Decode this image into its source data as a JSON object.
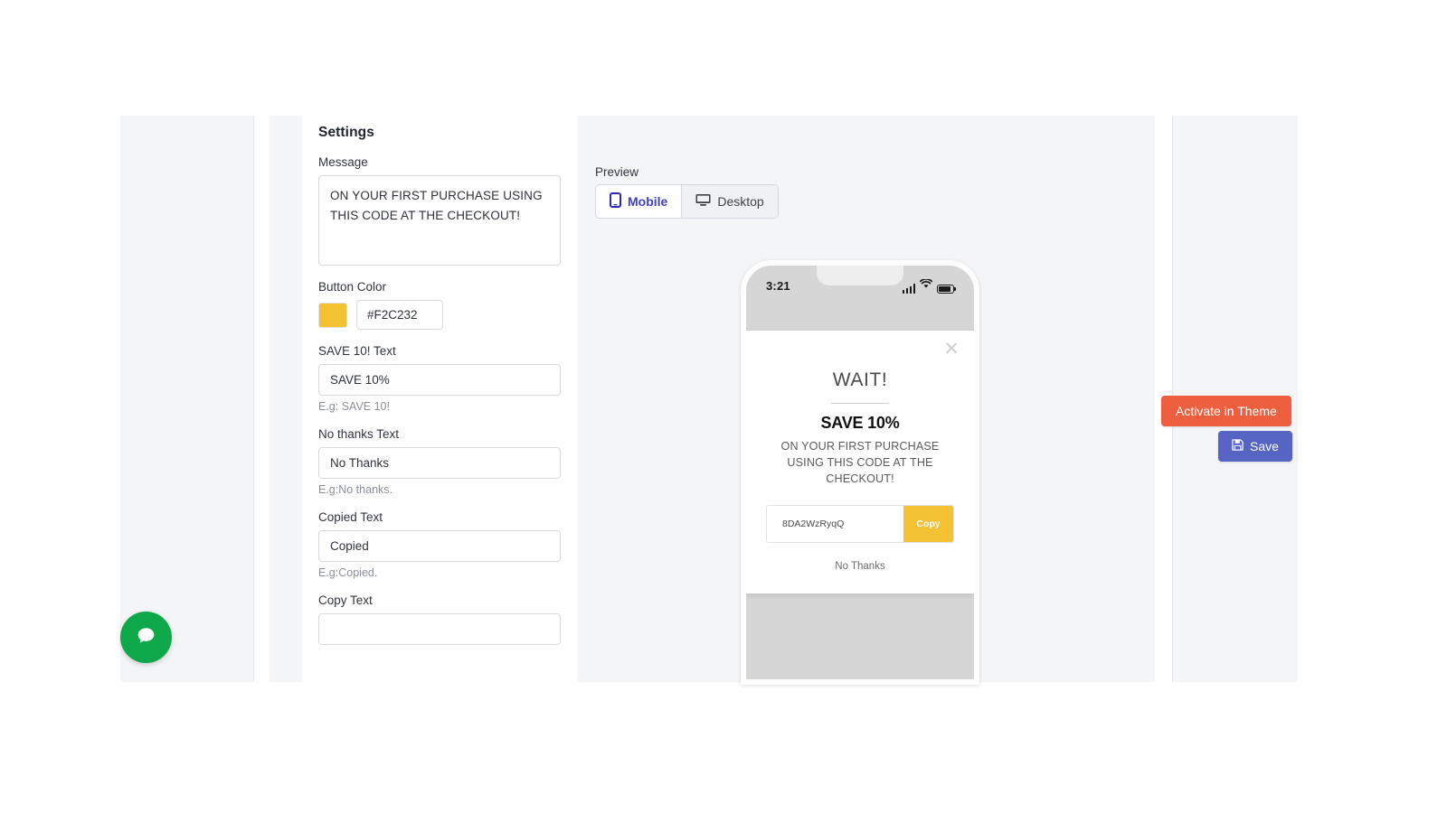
{
  "settings": {
    "title": "Settings",
    "fields": {
      "message": {
        "label": "Message",
        "value": "ON YOUR FIRST PURCHASE USING THIS CODE AT THE CHECKOUT!"
      },
      "button_color": {
        "label": "Button Color",
        "value": "#F2C232",
        "swatch_color": "#F2C232"
      },
      "save_text": {
        "label": "SAVE 10! Text",
        "value": "SAVE 10%",
        "hint": "E.g: SAVE 10!"
      },
      "no_thanks_text": {
        "label": "No thanks Text",
        "value": "No Thanks",
        "hint": "E.g:No thanks."
      },
      "copied_text": {
        "label": "Copied Text",
        "value": "Copied",
        "hint": "E.g:Copied."
      },
      "copy_text": {
        "label": "Copy Text",
        "value": ""
      }
    }
  },
  "preview": {
    "label": "Preview",
    "tabs": [
      {
        "label": "Mobile",
        "icon": "mobile-phone-icon",
        "active": true
      },
      {
        "label": "Desktop",
        "icon": "desktop-monitor-icon",
        "active": false
      }
    ],
    "phone": {
      "status_bar": {
        "time": "3:21",
        "icons": [
          "cellular-signal-icon",
          "wifi-icon",
          "battery-icon"
        ]
      },
      "modal": {
        "close_icon": "close-x-icon",
        "heading": "WAIT!",
        "subheading": "SAVE 10%",
        "message": "ON YOUR FIRST PURCHASE USING THIS CODE AT THE CHECKOUT!",
        "coupon_code": "8DA2WzRyqQ",
        "copy_button_label": "Copy",
        "copy_button_color": "#F2C232",
        "decline_label": "No Thanks"
      }
    }
  },
  "actions": {
    "activate": {
      "label": "Activate in Theme",
      "color": "#ed5f3e"
    },
    "save": {
      "label": "Save",
      "icon": "floppy-disk-save-icon",
      "color": "#5664c4"
    }
  },
  "chat_widget": {
    "icon": "chat-bubble-icon",
    "color": "#0ea84a"
  }
}
